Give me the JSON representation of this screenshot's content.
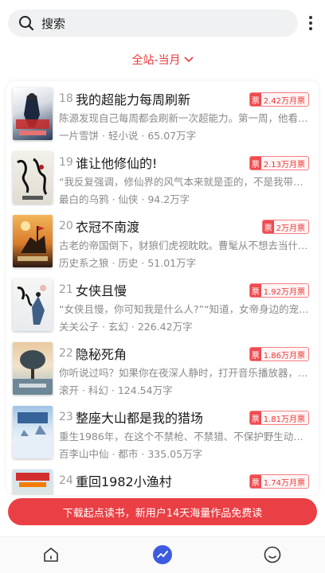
{
  "search": {
    "placeholder": "搜索"
  },
  "filter": {
    "label": "全站-当月"
  },
  "list": [
    {
      "rank": "18",
      "title": "我的超能力每周刷新",
      "votes": "2.42万月票",
      "desc": "陈源发现自己每周都会刷新一次超能力。第一周，他看…",
      "meta": "一片雪饼 · 轻小说 · 65.07万字"
    },
    {
      "rank": "19",
      "title": "谁让他修仙的!",
      "votes": "2.13万月票",
      "desc": "“我反复强调，修仙界的风气本来就是歪的，不是我带歪…",
      "meta": "最白的乌鸦 · 仙侠 · 94.2万字"
    },
    {
      "rank": "20",
      "title": "衣冠不南渡",
      "votes": "2万月票",
      "desc": "古老的帝国倒下，豺狼们虎视眈眈。曹髦从不想去当什…",
      "meta": "历史系之狼 · 历史 · 51.01万字"
    },
    {
      "rank": "21",
      "title": "女侠且慢",
      "votes": "1.92万月票",
      "desc": "“女侠且慢，你可知我是什么人?”“知道，女帝身边的宠…",
      "meta": "关关公子 · 玄幻 · 226.42万字"
    },
    {
      "rank": "22",
      "title": "隐秘死角",
      "votes": "1.86万月票",
      "desc": "你听说过吗？如果你在夜深人静时，打开音乐播放器，…",
      "meta": "滚开 · 科幻 · 124.54万字"
    },
    {
      "rank": "23",
      "title": "整座大山都是我的猎场",
      "votes": "1.81万月票",
      "desc": "重生1986年，在这个不禁枪、不禁猎、不保护野生动物…",
      "meta": "百李山中仙 · 都市 · 335.05万字"
    },
    {
      "rank": "24",
      "title": "重回1982小渔村",
      "votes": "1.74万月票",
      "desc": "",
      "meta": ""
    }
  ],
  "badge_icon_char": "票",
  "banner": {
    "text": "下载起点读书，新用户14天海量作品免费读"
  },
  "tabs": [
    {
      "name": "home-icon"
    },
    {
      "name": "trend-icon"
    },
    {
      "name": "smile-icon"
    }
  ],
  "colors": {
    "accent": "#e8393a",
    "banner": "#ea3f44",
    "tab_active": "#3e5be0"
  },
  "covers": [
    {
      "text": "我的超能力每周刷新"
    },
    {
      "text": "谁让他修仙的"
    },
    {
      "text": "衣冠不南渡"
    },
    {
      "text": "女侠且慢"
    },
    {
      "text": "隐秘死角"
    },
    {
      "text": "整座大山都是我的猎场"
    },
    {
      "text": "重回1982小渔村"
    }
  ]
}
